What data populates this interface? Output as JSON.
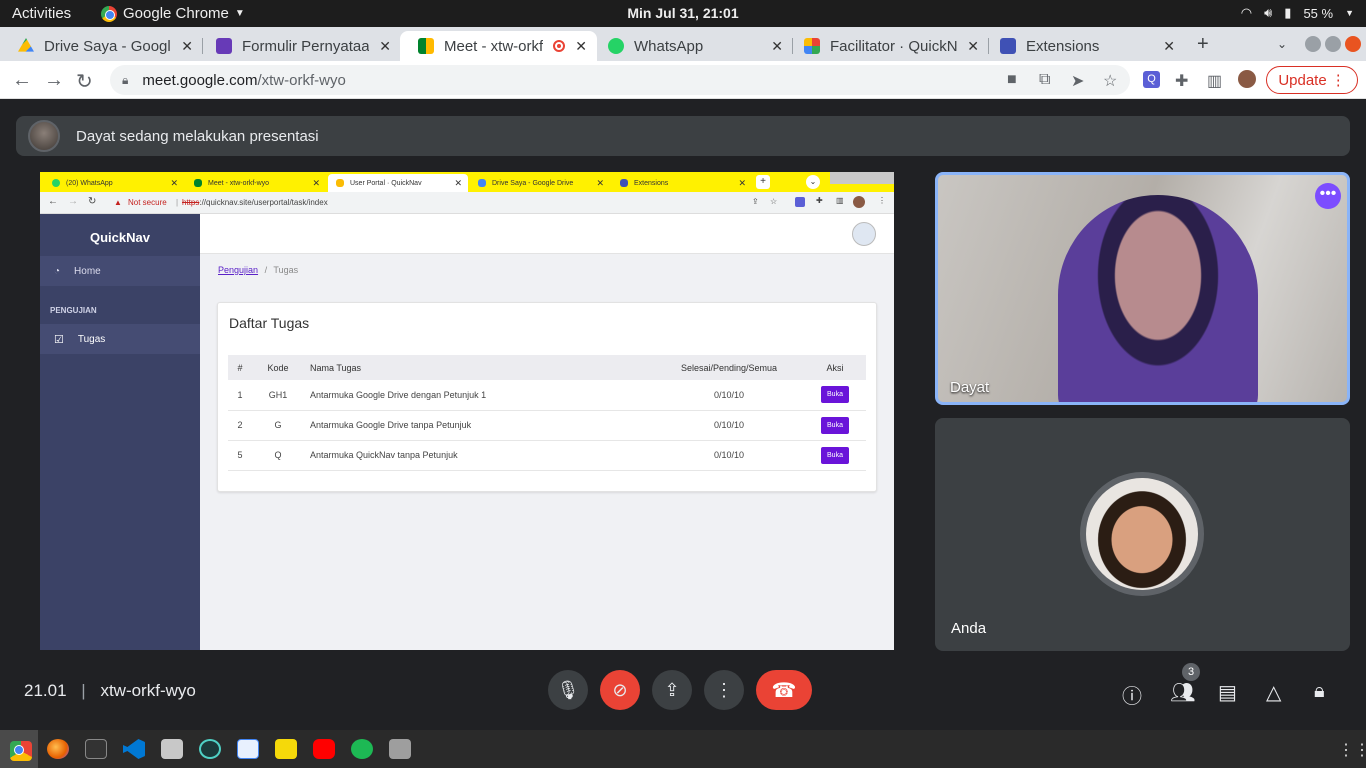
{
  "topbar": {
    "activities": "Activities",
    "app_name": "Google Chrome",
    "datetime": "Min Jul 31, 21:01",
    "battery": "55 %"
  },
  "tabs": [
    {
      "title": "Drive Saya - Google",
      "color": "#1a73e8"
    },
    {
      "title": "Formulir Pernyataa",
      "color": "#673ab7"
    },
    {
      "title": "Meet - xtw-orkf-",
      "color": "#00832d"
    },
    {
      "title": "WhatsApp",
      "color": "#25d366"
    },
    {
      "title": "Facilitator · QuickN",
      "color": "#f4b400"
    },
    {
      "title": "Extensions",
      "color": "#3f51b5"
    }
  ],
  "omnibox": {
    "url_host": "meet.google.com",
    "url_path": "/xtw-orkf-wyo",
    "update_label": "Update"
  },
  "banner": {
    "text": "Dayat sedang melakukan presentasi"
  },
  "shared": {
    "tabs": [
      "(20) WhatsApp",
      "Meet - xtw-orkf-wyo",
      "User Portal · QuickNav",
      "Drive Saya - Google Drive",
      "Extensions"
    ],
    "not_secure": "Not secure",
    "url_scheme": "https",
    "url_rest": "://quicknav.site/userportal/task/index",
    "brand": "QuickNav",
    "nav_home": "Home",
    "section": "PENGUJIAN",
    "nav_tugas": "Tugas",
    "breadcrumb_link": "Pengujian",
    "breadcrumb_current": "Tugas",
    "card_title": "Daftar Tugas",
    "columns": [
      "#",
      "Kode",
      "Nama Tugas",
      "Selesai/Pending/Semua",
      "Aksi"
    ],
    "rows": [
      {
        "no": "1",
        "kode": "GH1",
        "nama": "Antarmuka Google Drive dengan Petunjuk 1",
        "status": "0/10/10",
        "aksi": "Buka"
      },
      {
        "no": "2",
        "kode": "G",
        "nama": "Antarmuka Google Drive tanpa Petunjuk",
        "status": "0/10/10",
        "aksi": "Buka"
      },
      {
        "no": "5",
        "kode": "Q",
        "nama": "Antarmuka QuickNav tanpa Petunjuk",
        "status": "0/10/10",
        "aksi": "Buka"
      }
    ]
  },
  "participants": {
    "presenter_name": "Dayat",
    "self_name": "Anda",
    "count": "3"
  },
  "meeting": {
    "time": "21.01",
    "code": "xtw-orkf-wyo"
  }
}
